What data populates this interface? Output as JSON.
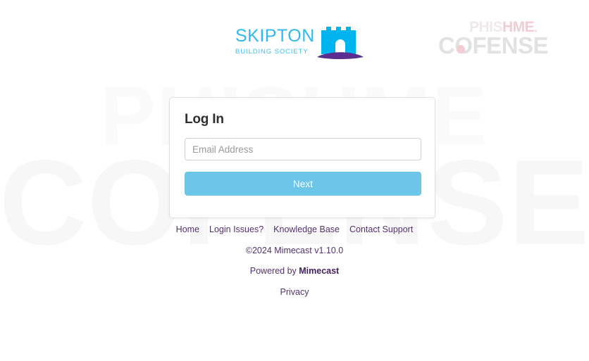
{
  "page": {
    "background_color": "#ffffff",
    "watermark": {
      "line1": "PHISHME",
      "line2": "COFENSE",
      "color": "#f8f8f9"
    }
  },
  "header": {
    "skipton_logo": {
      "name": "SKIPTON",
      "tagline": "BUILDING SOCIETY",
      "icon": "castle-icon",
      "primary_color": "#30b9ee",
      "accent_color": "#5b2d8e"
    },
    "cofense_logo": {
      "phishme_part1": "PHIS",
      "phishme_part2": "HME",
      "phishme_dot": ".",
      "cofense": "COFENSE",
      "gray_color": "#e2e2e2",
      "pink_color": "#f2ccd4"
    }
  },
  "login_card": {
    "title": "Log In",
    "email": {
      "placeholder": "Email Address",
      "value": ""
    },
    "next_label": "Next",
    "button_color": "#6dc5e8"
  },
  "footer": {
    "links": [
      {
        "label": "Home"
      },
      {
        "label": "Login Issues?"
      },
      {
        "label": "Knowledge Base"
      },
      {
        "label": "Contact Support"
      }
    ],
    "copyright": "©2024 Mimecast v1.10.0",
    "powered_by_prefix": "Powered by ",
    "powered_by_brand": "Mimecast",
    "privacy_label": "Privacy",
    "link_color": "#53306e"
  }
}
